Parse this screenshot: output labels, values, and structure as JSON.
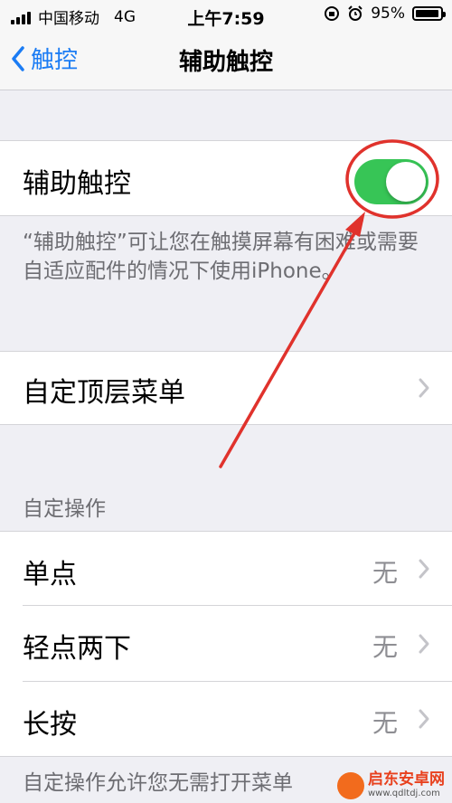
{
  "status_bar": {
    "carrier": "中国移动",
    "network": "4G",
    "time": "上午7:59",
    "battery": "95%",
    "battery_level": 0.95
  },
  "nav": {
    "back_label": "触控",
    "title": "辅助触控"
  },
  "assistive_touch": {
    "label": "辅助触控",
    "enabled": true,
    "footer": "“辅助触控”可让您在触摸屏幕有困难或需要自适应配件的情况下使用iPhone。"
  },
  "customize_top_menu": {
    "label": "自定顶层菜单"
  },
  "custom_actions": {
    "header": "自定操作",
    "items": [
      {
        "label": "单点",
        "value": "无"
      },
      {
        "label": "轻点两下",
        "value": "无"
      },
      {
        "label": "长按",
        "value": "无"
      }
    ],
    "footer": "自定操作允许您无需打开菜单"
  },
  "watermark": {
    "text": "启东安卓网",
    "url": "www.qdltdj.com"
  }
}
